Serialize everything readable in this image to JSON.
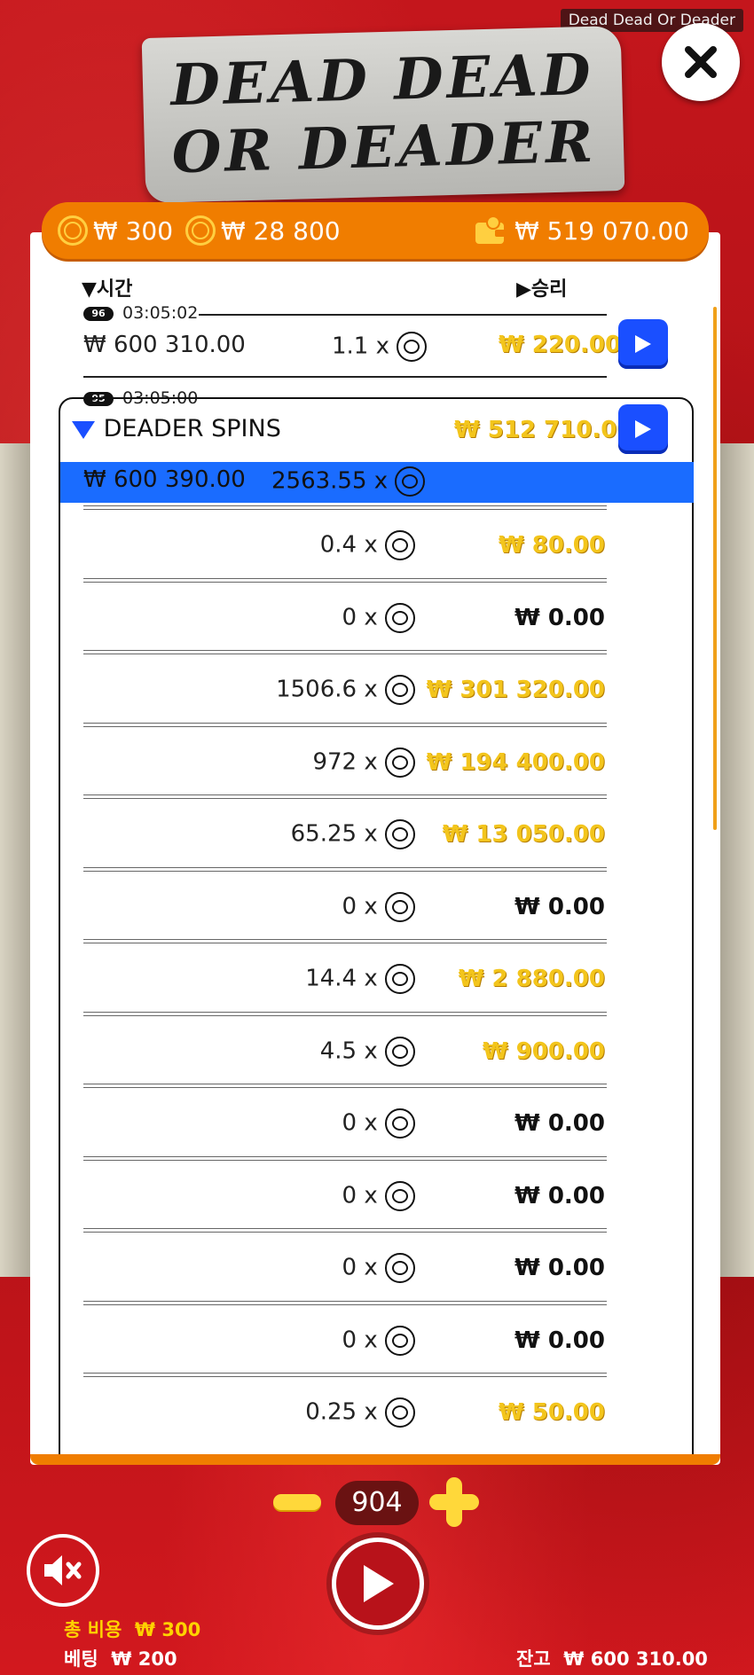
{
  "app": {
    "title_tag": "Dead Dead Or Deader",
    "logo_line1": "DEAD DEAD",
    "logo_line2": "OR DEADER"
  },
  "topbar": {
    "cost": "₩ 300",
    "bet_total": "₩ 28 800",
    "balance": "₩ 519 070.00"
  },
  "history": {
    "col_time": "시간",
    "col_win": "승리",
    "rounds": [
      {
        "id": "96",
        "time": "03:05:02",
        "balance": "₩ 600 310.00",
        "multiplier": "1.1 x",
        "win": "₩ 220.00"
      },
      {
        "id": "95",
        "time": "03:05:00",
        "feature": "DEADER SPINS",
        "win": "₩ 512 710.00",
        "summary": {
          "balance": "₩ 600 390.00",
          "multiplier": "2563.55 x"
        }
      }
    ],
    "spins": [
      {
        "multiplier": "0.4 x",
        "win": "₩ 80.00",
        "gold": true
      },
      {
        "multiplier": "0 x",
        "win": "₩ 0.00",
        "gold": false
      },
      {
        "multiplier": "1506.6 x",
        "win": "₩ 301 320.00",
        "gold": true
      },
      {
        "multiplier": "972 x",
        "win": "₩ 194 400.00",
        "gold": true
      },
      {
        "multiplier": "65.25 x",
        "win": "₩ 13 050.00",
        "gold": true
      },
      {
        "multiplier": "0 x",
        "win": "₩ 0.00",
        "gold": false
      },
      {
        "multiplier": "14.4 x",
        "win": "₩ 2 880.00",
        "gold": true
      },
      {
        "multiplier": "4.5 x",
        "win": "₩ 900.00",
        "gold": true
      },
      {
        "multiplier": "0 x",
        "win": "₩ 0.00",
        "gold": false
      },
      {
        "multiplier": "0 x",
        "win": "₩ 0.00",
        "gold": false
      },
      {
        "multiplier": "0 x",
        "win": "₩ 0.00",
        "gold": false
      },
      {
        "multiplier": "0 x",
        "win": "₩ 0.00",
        "gold": false
      },
      {
        "multiplier": "0.25 x",
        "win": "₩ 50.00",
        "gold": true
      }
    ]
  },
  "controls": {
    "bet_level": "904"
  },
  "footer": {
    "total_cost_label": "총 비용",
    "total_cost": "₩ 300",
    "bet_label": "베팅",
    "bet": "₩ 200",
    "balance_label": "잔고",
    "balance": "₩ 600 310.00"
  },
  "colors": {
    "accent": "#f07d00",
    "highlight": "#1a6cff",
    "gold": "#f3c51c"
  }
}
